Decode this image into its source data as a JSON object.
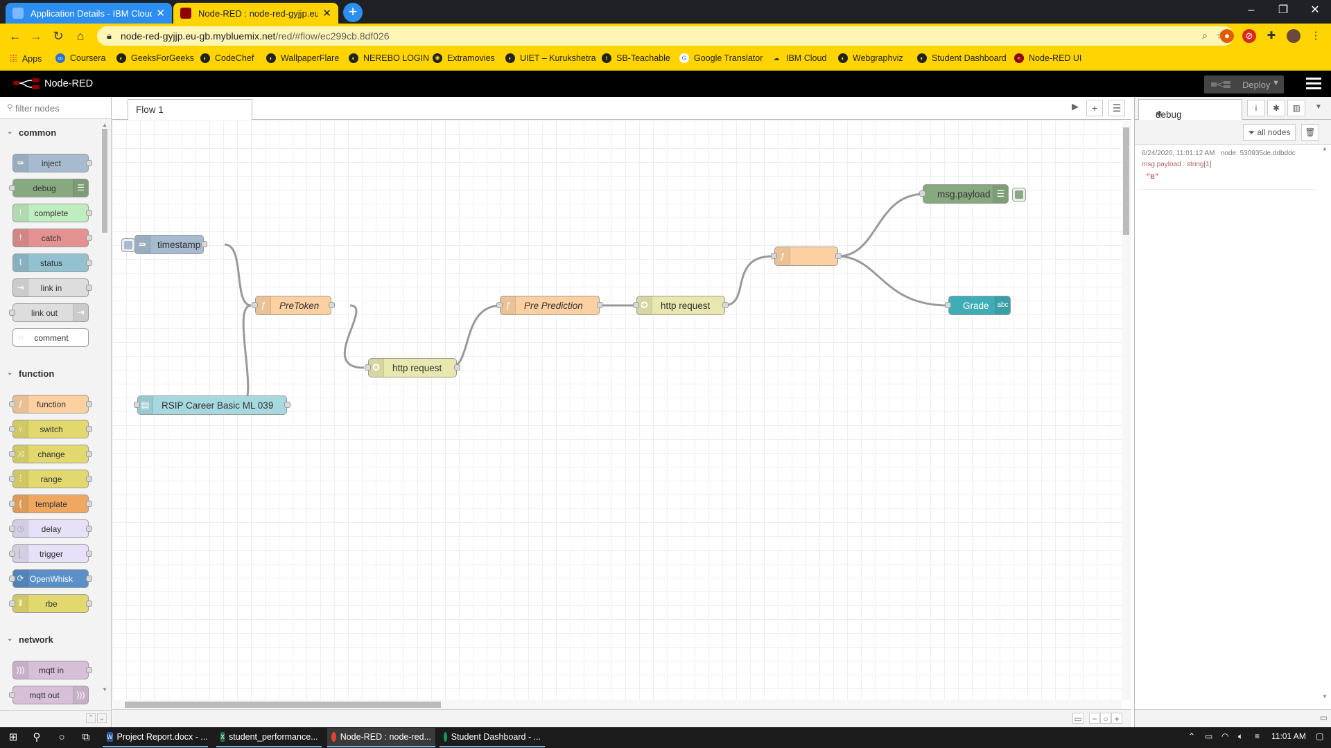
{
  "browser": {
    "tabs": [
      {
        "title": "Application Details - IBM Cloud",
        "favicon": "ibm-cloud-icon",
        "active": false
      },
      {
        "title": "Node-RED : node-red-gyjjp.eu-gb",
        "favicon": "node-red-icon",
        "active": true
      }
    ],
    "new_tab": "+",
    "window_controls": {
      "minimize": "–",
      "restore": "❐",
      "close": "✕"
    },
    "url_host": "node-red-gyjjp.eu-gb.mybluemix.net",
    "url_path": "/red/#flow/ec299cb.8df026",
    "bookmarks": [
      "Apps",
      "Coursera",
      "GeeksForGeeks",
      "CodeChef",
      "WallpaperFlare",
      "NEREBO LOGIN",
      "Extramovies",
      "UIET – Kurukshetra",
      "SB-Teachable",
      "Google Translator",
      "IBM Cloud",
      "Webgraphviz",
      "Student Dashboard",
      "Node-RED UI"
    ]
  },
  "nodered": {
    "app_title": "Node-RED",
    "deploy_label": "Deploy",
    "palette": {
      "filter_placeholder": "filter nodes",
      "categories": [
        {
          "name": "common",
          "nodes": [
            "inject",
            "debug",
            "complete",
            "catch",
            "status",
            "link in",
            "link out",
            "comment"
          ]
        },
        {
          "name": "function",
          "nodes": [
            "function",
            "switch",
            "change",
            "range",
            "template",
            "delay",
            "trigger",
            "OpenWhisk",
            "rbe"
          ]
        },
        {
          "name": "network",
          "nodes": [
            "mqtt in",
            "mqtt out"
          ]
        }
      ]
    },
    "workspace": {
      "tab_label": "Flow 1",
      "flow_nodes": {
        "timestamp": "timestamp",
        "pretoken": "PreToken",
        "http_request_1": "http request",
        "pre_prediction": "Pre Prediction",
        "http_request_2": "http request",
        "function_unnamed": "",
        "msg_payload": "msg.payload",
        "grade": "Grade",
        "rsip": "RSIP Career Basic ML 039"
      }
    },
    "sidebar": {
      "tab_label": "debug",
      "filter_label": "all nodes",
      "message": {
        "timestamp": "6/24/2020, 11:01:12 AM",
        "node": "node: 530935de.ddbddc",
        "topic": "msg.payload : string[1]",
        "value": "\"B\""
      }
    }
  },
  "taskbar": {
    "apps": [
      "Project Report.docx - ...",
      "student_performance...",
      "Node-RED : node-red...",
      "Student Dashboard - ..."
    ],
    "clock": "11:01 AM"
  },
  "colors": {
    "chrome_accent": "#ffd400",
    "inject": "#a6bbcf",
    "debug": "#87a980",
    "function": "#fdd0a2",
    "http": "#e7e7ae",
    "ui_text": "#3fadb5",
    "catch": "#e49191",
    "complete": "#c0edc0"
  }
}
